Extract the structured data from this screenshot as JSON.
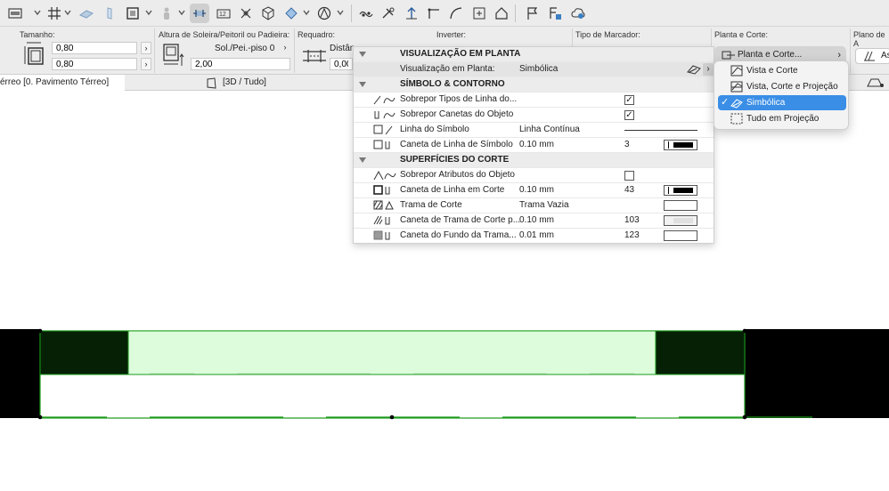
{
  "toolbar": {
    "icons": [
      "layer-marker-icon",
      "grid-icon",
      "slab-icon",
      "column-icon",
      "surface-icon",
      "door-figure-icon",
      "window-dimension-icon",
      "numbered-box-icon",
      "move-point-icon",
      "cube-icon",
      "target-icon",
      "split-icon",
      "trim-icon",
      "elevate-icon",
      "corner-icon",
      "curve-icon",
      "align-icon",
      "house-icon",
      "flag-icon",
      "attribute-icon",
      "cloud-icon"
    ]
  },
  "infobox": {
    "tamanho_label": "Tamanho:",
    "width_value": "0,80",
    "height_value": "0,80",
    "altura_label": "Altura de Soleira/Peitoril ou Padieira:",
    "sol_label": "Sol./Pei.-piso 0",
    "altura_value": "2,00",
    "requadro_label": "Requadro:",
    "distancia_label": "Distân",
    "distancia_value": "0,00",
    "inverter_label": "Inverter:",
    "marcador_label": "Tipo de Marcador:",
    "planta_label": "Planta e Corte:",
    "plano_label": "Plano de A",
    "planta_button": "Planta e Corte...",
    "as_button": "As"
  },
  "tabs": {
    "floor": "érreo [0. Pavimento Térreo]",
    "view3d": "[3D / Tudo]"
  },
  "panel": {
    "section1": "VISUALIZAÇÃO EM PLANTA",
    "vis_label": "Visualização em Planta:",
    "vis_value": "Simbólica",
    "section2": "SÍMBOLO & CONTORNO",
    "rows2": [
      {
        "name": "Sobrepor Tipos de Linha do...",
        "check": "✓"
      },
      {
        "name": "Sobrepor Canetas do Objeto",
        "check": "✓"
      },
      {
        "name": "Linha do Símbolo",
        "value": "Linha Contínua"
      },
      {
        "name": "Caneta de Linha de Símbolo",
        "value": "0.10 mm",
        "num": "3"
      }
    ],
    "section3": "SUPERFÍCIES DO CORTE",
    "rows3": [
      {
        "name": "Sobrepor Atributos do Objeto",
        "check": ""
      },
      {
        "name": "Caneta de Linha em Corte",
        "value": "0.10 mm",
        "num": "43"
      },
      {
        "name": "Trama de Corte",
        "value": "Trama Vazia"
      },
      {
        "name": "Caneta de Trama de Corte p...",
        "value": "0.10 mm",
        "num": "103"
      },
      {
        "name": "Caneta do Fundo da Trama...",
        "value": "0.01 mm",
        "num": "123"
      }
    ]
  },
  "dropdown": {
    "items": [
      "Vista e Corte",
      "Vista, Corte e Projeção",
      "Simbólica",
      "Tudo em Projeção"
    ],
    "selected": "Simbólica",
    "accent": "#3a8ee6"
  },
  "canvas": {
    "wall_color": "#000000",
    "outline_color": "#1a9a1a",
    "fill_color": "#dcfcdc",
    "dark_fill": "#062006"
  }
}
